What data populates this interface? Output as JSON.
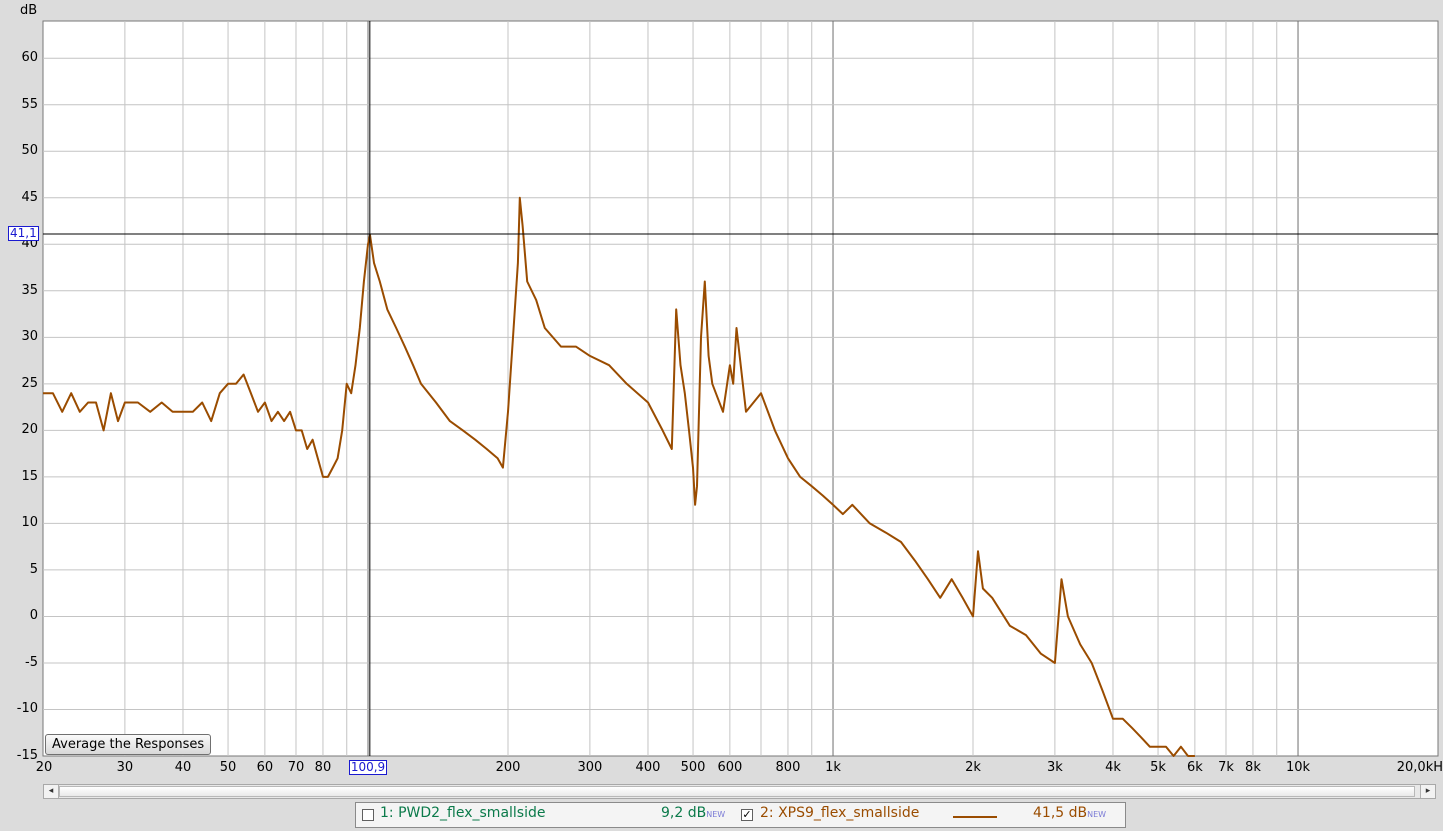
{
  "chart_data": {
    "type": "line",
    "ylabel": "dB",
    "x_scale": "log",
    "xlim": [
      20,
      20000
    ],
    "ylim": [
      -15,
      64
    ],
    "grid": true,
    "y_ticks": [
      "60",
      "55",
      "50",
      "45",
      "40",
      "35",
      "30",
      "25",
      "20",
      "15",
      "10",
      "5",
      "0",
      "-5",
      "-10",
      "-15"
    ],
    "y_tick_values": [
      60,
      55,
      50,
      45,
      40,
      35,
      30,
      25,
      20,
      15,
      10,
      5,
      0,
      -5,
      -10,
      -15
    ],
    "x_ticks": [
      "20",
      "30",
      "40",
      "50",
      "60",
      "70",
      "80",
      "200",
      "300",
      "400",
      "500",
      "600",
      "800",
      "1k",
      "2k",
      "3k",
      "4k",
      "5k",
      "6k",
      "7k",
      "8k",
      "10k",
      "20,0kH"
    ],
    "x_tick_values": [
      20,
      30,
      40,
      50,
      60,
      70,
      80,
      200,
      300,
      400,
      500,
      600,
      800,
      1000,
      2000,
      3000,
      4000,
      5000,
      6000,
      7000,
      8000,
      10000,
      20000
    ],
    "cursor": {
      "x": 100.9,
      "y": 41.1,
      "x_label": "100,9",
      "y_label": "41,1"
    },
    "series": [
      {
        "name": "2: XPS9_flex_smallside",
        "color": "#9a4c00",
        "x": [
          20,
          21,
          22,
          23,
          24,
          25,
          26,
          27,
          28,
          29,
          30,
          32,
          34,
          36,
          38,
          40,
          42,
          44,
          46,
          48,
          50,
          52,
          54,
          56,
          58,
          60,
          62,
          64,
          66,
          68,
          70,
          72,
          74,
          76,
          78,
          80,
          82,
          84,
          86,
          88,
          90,
          92,
          94,
          96,
          98,
          100,
          101,
          103,
          106,
          110,
          115,
          120,
          125,
          130,
          140,
          150,
          160,
          170,
          180,
          190,
          195,
          200,
          205,
          210,
          212,
          215,
          220,
          230,
          240,
          260,
          280,
          300,
          330,
          360,
          400,
          430,
          450,
          460,
          470,
          480,
          490,
          500,
          505,
          510,
          520,
          530,
          540,
          550,
          580,
          600,
          610,
          620,
          650,
          700,
          750,
          800,
          850,
          900,
          950,
          1000,
          1050,
          1100,
          1200,
          1300,
          1400,
          1500,
          1600,
          1700,
          1800,
          1900,
          2000,
          2050,
          2100,
          2200,
          2400,
          2600,
          2800,
          3000,
          3100,
          3200,
          3400,
          3600,
          3800,
          4000,
          4200,
          4400,
          4600,
          4800,
          5000,
          5200,
          5400,
          5600,
          5800,
          6000
        ],
        "y": [
          24,
          24,
          22,
          24,
          22,
          23,
          23,
          20,
          24,
          21,
          23,
          23,
          22,
          23,
          22,
          22,
          22,
          23,
          21,
          24,
          25,
          25,
          26,
          24,
          22,
          23,
          21,
          22,
          21,
          22,
          20,
          20,
          18,
          19,
          17,
          15,
          15,
          16,
          17,
          20,
          25,
          24,
          27,
          31,
          36,
          40,
          41,
          38,
          36,
          33,
          31,
          29,
          27,
          25,
          23,
          21,
          20,
          19,
          18,
          17,
          16,
          22,
          30,
          38,
          45,
          42,
          36,
          34,
          31,
          29,
          29,
          28,
          27,
          25,
          23,
          20,
          18,
          33,
          27,
          24,
          20,
          16,
          12,
          14,
          30,
          36,
          28,
          25,
          22,
          27,
          25,
          31,
          22,
          24,
          20,
          17,
          15,
          14,
          13,
          12,
          11,
          12,
          10,
          9,
          8,
          6,
          4,
          2,
          4,
          2,
          0,
          7,
          3,
          2,
          -1,
          -2,
          -4,
          -5,
          4,
          0,
          -3,
          -5,
          -8,
          -11,
          -11,
          -12,
          -13,
          -14,
          -14,
          -14,
          -15,
          -14,
          -15,
          -15
        ]
      }
    ]
  },
  "ui": {
    "avg_button_label": "Average the Responses",
    "scroll_left_glyph": "◂",
    "scroll_right_glyph": "▸"
  },
  "legend": {
    "item1": {
      "label": "1: PWD2_flex_smallside",
      "value": "9,2 dB",
      "badge": "NEW",
      "checked": false,
      "color": "#0b7a4a"
    },
    "item2": {
      "label": "2: XPS9_flex_smallside",
      "value": "41,5 dB",
      "badge": "NEW",
      "checked": true,
      "color": "#9a4c00"
    }
  }
}
